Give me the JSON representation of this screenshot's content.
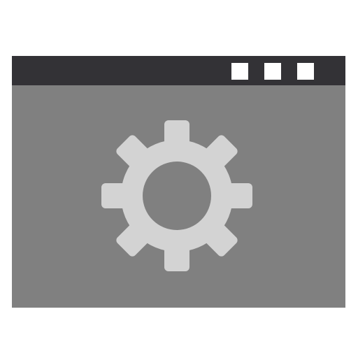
{
  "window": {
    "titlebar_color": "#333236",
    "content_color": "#808080",
    "button_color": "#ffffff",
    "buttons": [
      {
        "icon": "window-button-square"
      },
      {
        "icon": "window-button-square"
      },
      {
        "icon": "window-button-square"
      }
    ]
  },
  "content": {
    "icon": "gear-icon",
    "icon_color": "#d3d3d3"
  }
}
